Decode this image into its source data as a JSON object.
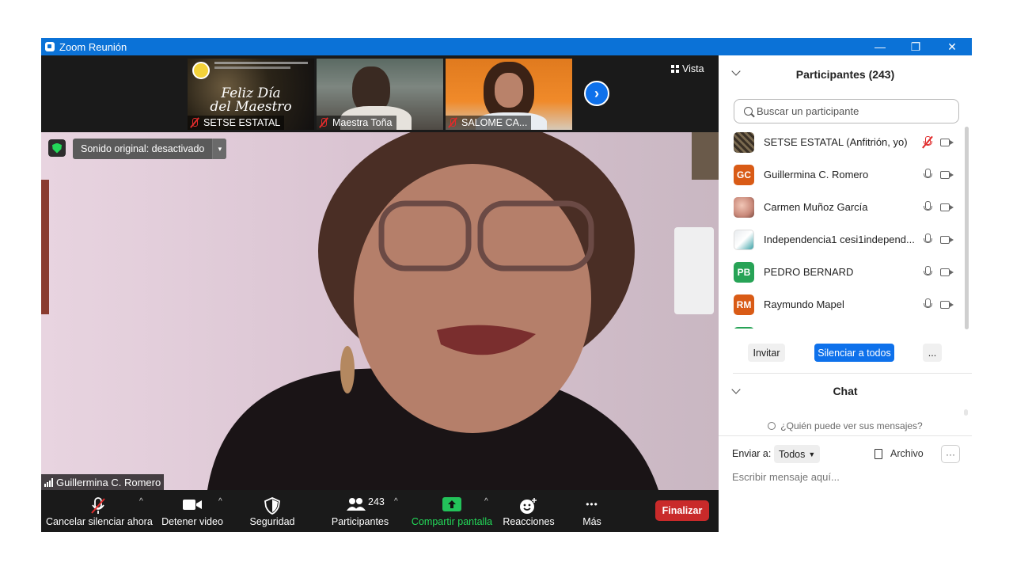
{
  "window": {
    "title": "Zoom Reunión",
    "minimize": "—",
    "restore": "❐",
    "close": "✕"
  },
  "strip": {
    "thumbs": [
      {
        "name": "SETSE ESTATAL",
        "banner_line1": "Feliz Día",
        "banner_line2": "del Maestro"
      },
      {
        "name": "Maestra Toña"
      },
      {
        "name": "SALOME CA..."
      }
    ],
    "next": "›",
    "view_label": "Vista"
  },
  "main": {
    "sound_label": "Sonido original: desactivado",
    "sound_dd": "▾",
    "speaker_name": "Guillermina C. Romero"
  },
  "toolbar": {
    "unmute": "Cancelar silenciar ahora",
    "stop_video": "Detener video",
    "security": "Seguridad",
    "participants": "Participantes",
    "participants_count": "243",
    "share": "Compartir pantalla",
    "reactions": "Reacciones",
    "more": "Más",
    "end": "Finalizar",
    "caret": "^",
    "more_dots": "•••"
  },
  "panel": {
    "title": "Participantes (243)",
    "search_placeholder": "Buscar un participante",
    "participants": [
      {
        "name": "SETSE ESTATAL (Anfitrión, yo)",
        "initials": "",
        "color": "#6b5a3e",
        "mic": "off"
      },
      {
        "name": "Guillermina C. Romero",
        "initials": "GC",
        "color": "#d95b16",
        "mic": "on"
      },
      {
        "name": "Carmen Muñoz García",
        "initials": "",
        "color": "#c9897a",
        "mic": "on"
      },
      {
        "name": "Independencia1 cesi1independ...",
        "initials": "",
        "color": "#e8ecef",
        "mic": "on"
      },
      {
        "name": "PEDRO BERNARD",
        "initials": "PB",
        "color": "#27a356",
        "mic": "on"
      },
      {
        "name": "Raymundo Mapel",
        "initials": "RM",
        "color": "#d95b16",
        "mic": "on"
      }
    ],
    "invite": "Invitar",
    "mute_all": "Silenciar a todos",
    "more": "..."
  },
  "chat": {
    "title": "Chat",
    "who_can_see": "¿Quién puede ver sus mensajes?",
    "send_to_label": "Enviar a:",
    "send_to_value": "Todos",
    "file": "Archivo",
    "more": "···",
    "input_placeholder": "Escribir mensaje aquí..."
  }
}
